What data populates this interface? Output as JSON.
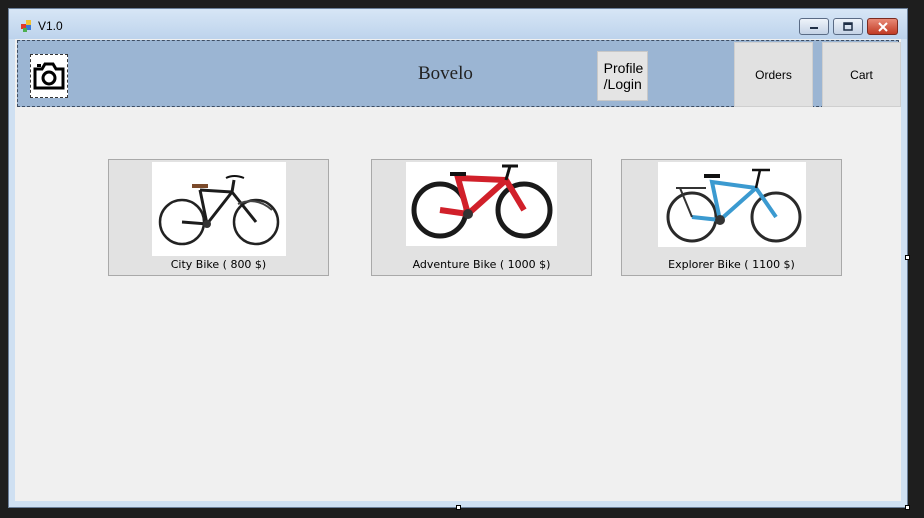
{
  "window": {
    "title": "V1.0",
    "controls": {
      "minimize_icon": "minimize-icon",
      "maximize_icon": "maximize-icon",
      "close_icon": "close-icon"
    }
  },
  "header": {
    "brand": "Bovelo",
    "logo_icon": "camera-icon",
    "profile_label": "Profile\n/Login",
    "orders_label": "Orders",
    "cart_label": "Cart",
    "header_color": "#9bb5d3"
  },
  "products": [
    {
      "name": "City Bike",
      "price": "( 800 $)",
      "caption": "City Bike   ( 800 $)",
      "frame_color": "#1c1c1c"
    },
    {
      "name": "Adventure Bike",
      "price": "( 1000 $)",
      "caption": "Adventure Bike   ( 1000 $)",
      "frame_color": "#d1202a"
    },
    {
      "name": "Explorer Bike",
      "price": "( 1100 $)",
      "caption": "Explorer Bike   ( 1100 $)",
      "frame_color": "#3b9ad0"
    }
  ]
}
